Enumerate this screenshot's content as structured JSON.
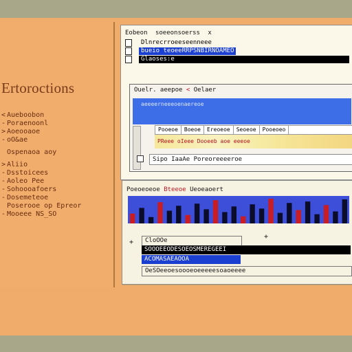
{
  "sidebar": {
    "title": "Ertoroctions",
    "items": [
      {
        "bullet": "<",
        "label": "Aueboobon"
      },
      {
        "bullet": "-",
        "label": "Poraenoonl"
      },
      {
        "bullet": ">",
        "label": "Aoeooaoe"
      },
      {
        "bullet": "-",
        "label": "oO&ae"
      },
      {
        "bullet": "",
        "label": "Ospenaoa aoy"
      },
      {
        "bullet": ">",
        "label": "Aliio"
      },
      {
        "bullet": "-",
        "label": "Dsstoicees"
      },
      {
        "bullet": "-",
        "label": "Aoleo Pee"
      },
      {
        "bullet": "-",
        "label": "Sohoooafoers"
      },
      {
        "bullet": "-",
        "label": "Dosemeteoe"
      },
      {
        "bullet": "",
        "label": "Poserooe op Epreor"
      },
      {
        "bullet": "-",
        "label": "Mooeee NS_SO"
      }
    ]
  },
  "top_window": {
    "toolbar": [
      "Eobeon",
      "soeeonsoerss",
      "x"
    ],
    "files": [
      {
        "name": "Dlnrecrroeeseenneee",
        "style": "plain"
      },
      {
        "name": "bueio teoeeRRPSNBIRNOAMEO",
        "style": "blue"
      },
      {
        "name": "Glaoses:e",
        "style": "black"
      }
    ],
    "dialog": {
      "title_left": "Ouelr. aeepoe",
      "title_red": "<",
      "title_right": "Oelaer",
      "band_label": "aeeeerneeeoenaereoe",
      "tabs": [
        "Pooeoe",
        "Boeoe",
        "Ereoeoe",
        "Seoeoe",
        "Pooeoeo"
      ],
      "strip_text": "PReee oIeee Dooeeb aoe eeeoe",
      "input_value": "Sipo IaaAe Poreoreeeeroe"
    }
  },
  "bottom_window": {
    "header_left": "Poeoeoeoe",
    "header_hot": "Bteeoe",
    "header_right": "Ueoeaoert",
    "files": [
      {
        "name": "CloOOe",
        "style": "plain"
      },
      {
        "name": "SOOOEEODESOEOSMEREGEEI",
        "style": "black"
      },
      {
        "name": "ACOMASAEAOOA",
        "style": "blue"
      },
      {
        "name": "OeSOeeoesoooeoeeeeesoaoeeee",
        "style": "plain"
      }
    ]
  },
  "chart_data": {
    "type": "bar",
    "categories": [],
    "values": [
      14,
      22,
      9,
      30,
      18,
      25,
      12,
      28,
      20,
      33,
      16,
      24,
      10,
      27,
      21,
      35,
      15,
      29,
      19,
      31,
      13,
      26,
      17,
      34
    ],
    "bar_colors": [
      "#0b0b2a",
      "#c81d25"
    ],
    "background": "#3d4fd8"
  },
  "colors": {
    "frame": "#efac6a",
    "accent_blue": "#1b3fd1",
    "accent_red": "#c1121f"
  }
}
